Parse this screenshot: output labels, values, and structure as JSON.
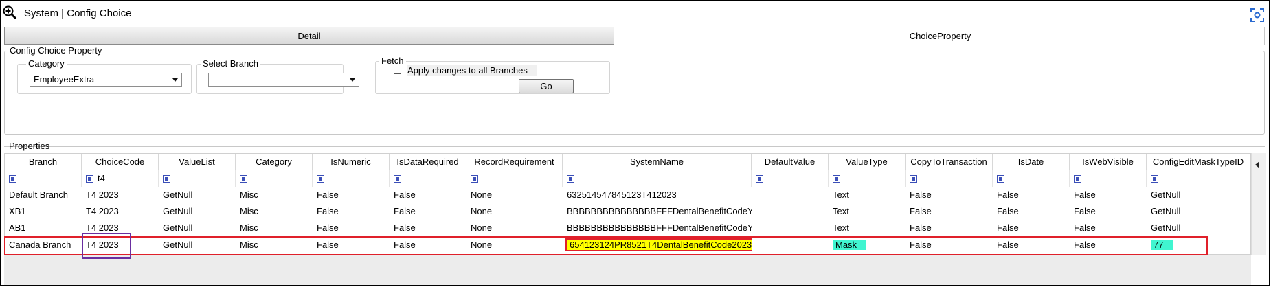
{
  "window": {
    "title": "System | Config Choice"
  },
  "tabs": [
    {
      "label": "Detail"
    },
    {
      "label": "ChoiceProperty"
    }
  ],
  "config_group": {
    "legend": "Config Choice Property",
    "category": {
      "legend": "Category",
      "value": "EmployeeExtra"
    },
    "branch": {
      "legend": "Select Branch",
      "value": ""
    },
    "fetch": {
      "legend": "Fetch",
      "apply_label": "Apply changes to all Branches",
      "go_label": "Go"
    }
  },
  "properties": {
    "legend": "Properties",
    "columns": [
      "Branch",
      "ChoiceCode",
      "ValueList",
      "Category",
      "IsNumeric",
      "IsDataRequired",
      "RecordRequirement",
      "SystemName",
      "DefaultValue",
      "ValueType",
      "CopyToTransaction",
      "IsDate",
      "IsWebVisible",
      "ConfigEditMaskTypeID"
    ],
    "filter_choicecode": "t4",
    "rows": [
      [
        "Default Branch",
        "T4 2023",
        "GetNull",
        "Misc",
        "False",
        "False",
        "None",
        "632514547845123T412023",
        "",
        "Text",
        "False",
        "False",
        "False",
        "GetNull"
      ],
      [
        "XB1",
        "T4 2023",
        "GetNull",
        "Misc",
        "False",
        "False",
        "None",
        "BBBBBBBBBBBBBBBFFFDentalBenefitCodeYYYY",
        "",
        "Text",
        "False",
        "False",
        "False",
        "GetNull"
      ],
      [
        "AB1",
        "T4 2023",
        "GetNull",
        "Misc",
        "False",
        "False",
        "None",
        "BBBBBBBBBBBBBBBFFFDentalBenefitCodeYYYY",
        "",
        "Text",
        "False",
        "False",
        "False",
        "GetNull"
      ],
      [
        "Canada Branch",
        "T4 2023",
        "GetNull",
        "Misc",
        "False",
        "False",
        "None",
        "654123124PR8521T4DentalBenefitCode2023",
        "",
        "Mask",
        "False",
        "False",
        "False",
        "77"
      ]
    ]
  },
  "colors": {
    "highlight_box": "#e0202a",
    "choicecode_box": "#6a2ea0",
    "systemname_highlight": "#ffff00",
    "valuetype_highlight": "#40f5d0"
  }
}
